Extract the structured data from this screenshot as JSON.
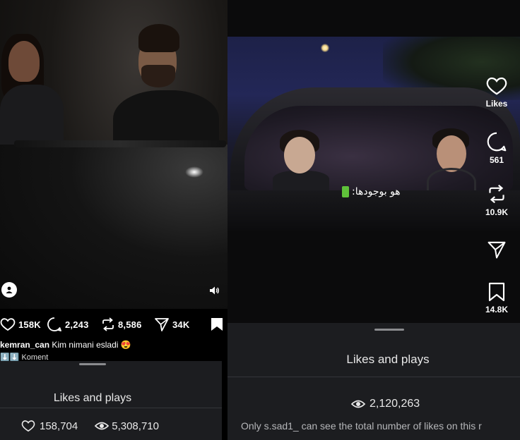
{
  "left": {
    "metrics": {
      "likes": "158K",
      "comments": "2,243",
      "reposts": "8,586",
      "shares": "34K"
    },
    "caption": {
      "username": "kemran_can",
      "text": "Kim nimani esladi 😍",
      "line2": "⬇️⬇️ Koment"
    },
    "sheet": {
      "title": "Likes and plays",
      "likes": "158,704",
      "plays": "5,308,710"
    }
  },
  "right": {
    "subtitle": "هو بوجودها:",
    "rail": {
      "likes_label": "Likes",
      "comments": "561",
      "reposts": "10.9K",
      "saves": "14.8K"
    },
    "sheet": {
      "title": "Likes and plays",
      "plays": "2,120,263",
      "note": "Only s.sad1_ can see the total number of likes on this r"
    }
  },
  "icons": [
    "heart-icon",
    "comment-icon",
    "repost-icon",
    "share-icon",
    "bookmark-icon",
    "eye-icon",
    "person-icon",
    "speaker-icon"
  ]
}
